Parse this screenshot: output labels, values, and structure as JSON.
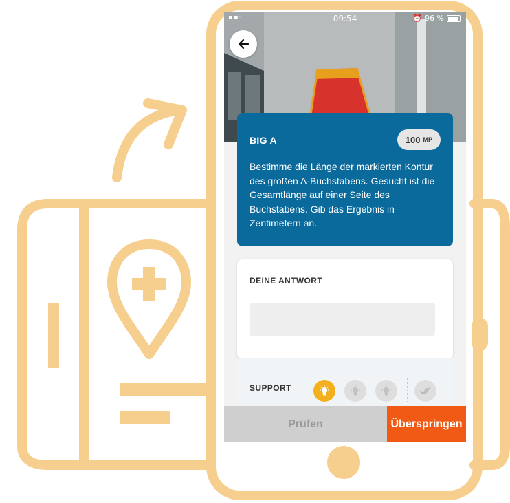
{
  "status_bar": {
    "time": "09:54",
    "signal": "▪▪ᐧ",
    "battery_text": "96 %"
  },
  "task": {
    "title": "BIG A",
    "points_value": "100",
    "points_unit": "MP",
    "description": "Bestimme die Länge der markierten Kontur des großen A-Buchstabens. Gesucht ist die Gesamtlänge auf einer Seite des Buchstabens. Gib das Ergebnis in Zentimetern an."
  },
  "answer": {
    "label": "DEINE ANTWORT",
    "value": "",
    "placeholder": ""
  },
  "support": {
    "label": "SUPPORT",
    "hints": [
      {
        "icon": "lightbulb-icon",
        "active": true
      },
      {
        "icon": "lightbulb-icon",
        "active": false
      },
      {
        "icon": "lightbulb-icon",
        "active": false
      },
      {
        "icon": "double-check-icon",
        "active": false
      }
    ]
  },
  "actions": {
    "check_label": "Prüfen",
    "skip_label": "Überspringen"
  },
  "colors": {
    "illustration": "#f6cf8f",
    "task_card": "#0a6a9c",
    "hint_active": "#f2b01e",
    "hint_inactive": "#dedede",
    "check_button_bg": "#cfcfcf",
    "skip_button_bg": "#f05a14"
  },
  "icons": {
    "back": "arrow-left-icon",
    "wifi": "wifi-icon",
    "alarm": "alarm-icon",
    "battery": "battery-icon"
  }
}
